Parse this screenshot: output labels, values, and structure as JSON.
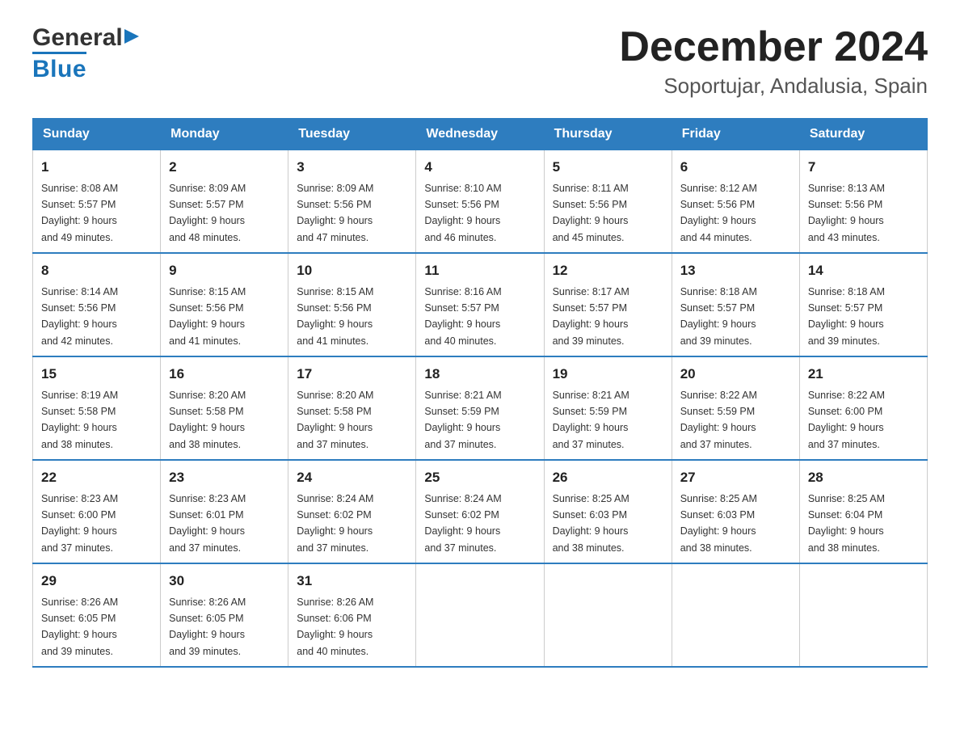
{
  "header": {
    "logo_general": "General",
    "logo_blue": "Blue",
    "main_title": "December 2024",
    "subtitle": "Soportujar, Andalusia, Spain"
  },
  "calendar": {
    "weekdays": [
      "Sunday",
      "Monday",
      "Tuesday",
      "Wednesday",
      "Thursday",
      "Friday",
      "Saturday"
    ],
    "weeks": [
      [
        {
          "day": "1",
          "sunrise": "8:08 AM",
          "sunset": "5:57 PM",
          "daylight": "9 hours and 49 minutes."
        },
        {
          "day": "2",
          "sunrise": "8:09 AM",
          "sunset": "5:57 PM",
          "daylight": "9 hours and 48 minutes."
        },
        {
          "day": "3",
          "sunrise": "8:09 AM",
          "sunset": "5:56 PM",
          "daylight": "9 hours and 47 minutes."
        },
        {
          "day": "4",
          "sunrise": "8:10 AM",
          "sunset": "5:56 PM",
          "daylight": "9 hours and 46 minutes."
        },
        {
          "day": "5",
          "sunrise": "8:11 AM",
          "sunset": "5:56 PM",
          "daylight": "9 hours and 45 minutes."
        },
        {
          "day": "6",
          "sunrise": "8:12 AM",
          "sunset": "5:56 PM",
          "daylight": "9 hours and 44 minutes."
        },
        {
          "day": "7",
          "sunrise": "8:13 AM",
          "sunset": "5:56 PM",
          "daylight": "9 hours and 43 minutes."
        }
      ],
      [
        {
          "day": "8",
          "sunrise": "8:14 AM",
          "sunset": "5:56 PM",
          "daylight": "9 hours and 42 minutes."
        },
        {
          "day": "9",
          "sunrise": "8:15 AM",
          "sunset": "5:56 PM",
          "daylight": "9 hours and 41 minutes."
        },
        {
          "day": "10",
          "sunrise": "8:15 AM",
          "sunset": "5:56 PM",
          "daylight": "9 hours and 41 minutes."
        },
        {
          "day": "11",
          "sunrise": "8:16 AM",
          "sunset": "5:57 PM",
          "daylight": "9 hours and 40 minutes."
        },
        {
          "day": "12",
          "sunrise": "8:17 AM",
          "sunset": "5:57 PM",
          "daylight": "9 hours and 39 minutes."
        },
        {
          "day": "13",
          "sunrise": "8:18 AM",
          "sunset": "5:57 PM",
          "daylight": "9 hours and 39 minutes."
        },
        {
          "day": "14",
          "sunrise": "8:18 AM",
          "sunset": "5:57 PM",
          "daylight": "9 hours and 39 minutes."
        }
      ],
      [
        {
          "day": "15",
          "sunrise": "8:19 AM",
          "sunset": "5:58 PM",
          "daylight": "9 hours and 38 minutes."
        },
        {
          "day": "16",
          "sunrise": "8:20 AM",
          "sunset": "5:58 PM",
          "daylight": "9 hours and 38 minutes."
        },
        {
          "day": "17",
          "sunrise": "8:20 AM",
          "sunset": "5:58 PM",
          "daylight": "9 hours and 37 minutes."
        },
        {
          "day": "18",
          "sunrise": "8:21 AM",
          "sunset": "5:59 PM",
          "daylight": "9 hours and 37 minutes."
        },
        {
          "day": "19",
          "sunrise": "8:21 AM",
          "sunset": "5:59 PM",
          "daylight": "9 hours and 37 minutes."
        },
        {
          "day": "20",
          "sunrise": "8:22 AM",
          "sunset": "5:59 PM",
          "daylight": "9 hours and 37 minutes."
        },
        {
          "day": "21",
          "sunrise": "8:22 AM",
          "sunset": "6:00 PM",
          "daylight": "9 hours and 37 minutes."
        }
      ],
      [
        {
          "day": "22",
          "sunrise": "8:23 AM",
          "sunset": "6:00 PM",
          "daylight": "9 hours and 37 minutes."
        },
        {
          "day": "23",
          "sunrise": "8:23 AM",
          "sunset": "6:01 PM",
          "daylight": "9 hours and 37 minutes."
        },
        {
          "day": "24",
          "sunrise": "8:24 AM",
          "sunset": "6:02 PM",
          "daylight": "9 hours and 37 minutes."
        },
        {
          "day": "25",
          "sunrise": "8:24 AM",
          "sunset": "6:02 PM",
          "daylight": "9 hours and 37 minutes."
        },
        {
          "day": "26",
          "sunrise": "8:25 AM",
          "sunset": "6:03 PM",
          "daylight": "9 hours and 38 minutes."
        },
        {
          "day": "27",
          "sunrise": "8:25 AM",
          "sunset": "6:03 PM",
          "daylight": "9 hours and 38 minutes."
        },
        {
          "day": "28",
          "sunrise": "8:25 AM",
          "sunset": "6:04 PM",
          "daylight": "9 hours and 38 minutes."
        }
      ],
      [
        {
          "day": "29",
          "sunrise": "8:26 AM",
          "sunset": "6:05 PM",
          "daylight": "9 hours and 39 minutes."
        },
        {
          "day": "30",
          "sunrise": "8:26 AM",
          "sunset": "6:05 PM",
          "daylight": "9 hours and 39 minutes."
        },
        {
          "day": "31",
          "sunrise": "8:26 AM",
          "sunset": "6:06 PM",
          "daylight": "9 hours and 40 minutes."
        },
        null,
        null,
        null,
        null
      ]
    ]
  }
}
